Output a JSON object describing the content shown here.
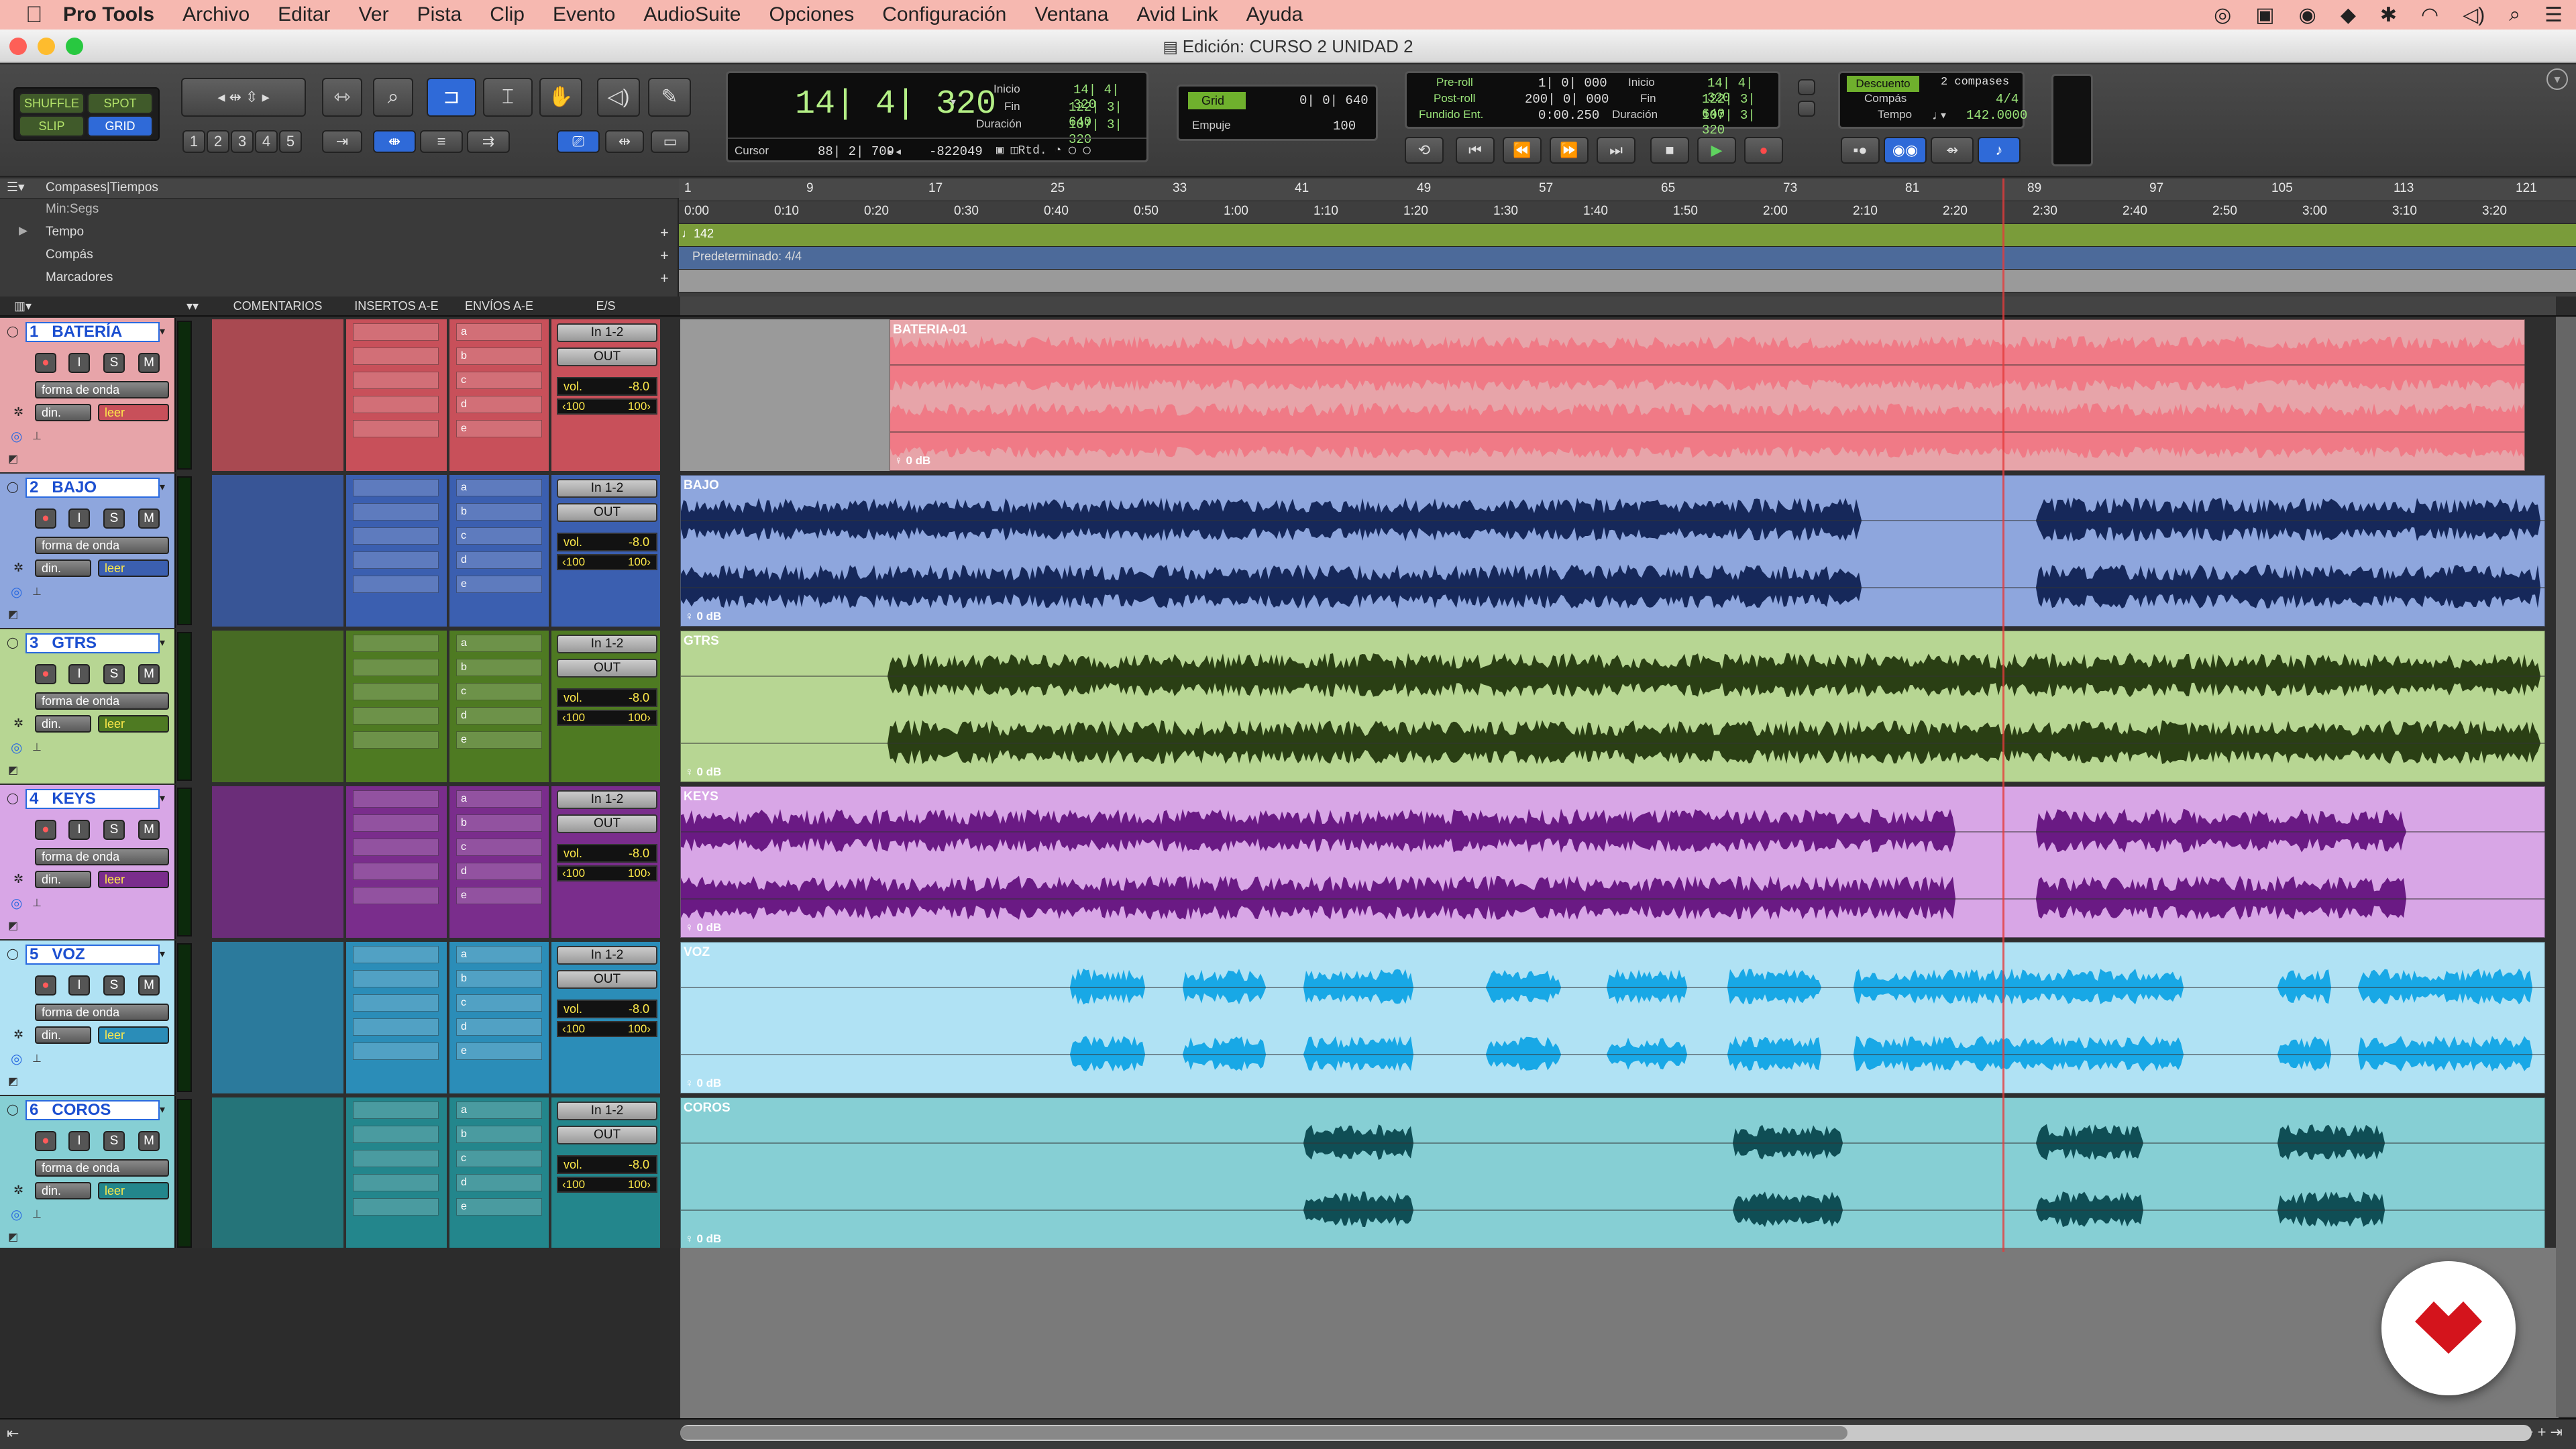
{
  "menubar": {
    "app": "Pro Tools",
    "items": [
      "Archivo",
      "Editar",
      "Ver",
      "Pista",
      "Clip",
      "Evento",
      "AudioSuite",
      "Opciones",
      "Configuración",
      "Ventana",
      "Avid Link",
      "Ayuda"
    ]
  },
  "window": {
    "title": "Edición: CURSO 2 UNIDAD 2"
  },
  "toolbar": {
    "modes": [
      "SHUFFLE",
      "SPOT",
      "SLIP",
      "GRID"
    ],
    "zoom_presets": [
      "1",
      "2",
      "3",
      "4",
      "5"
    ],
    "main_counter": "14| 4| 320",
    "sel_start_label": "Inicio",
    "sel_start": "14| 4| 320",
    "sel_end_label": "Fin",
    "sel_end": "122| 3| 640",
    "sel_len_label": "Duración",
    "sel_len": "107| 3| 320",
    "cursor_label": "Cursor",
    "cursor_value": "88| 2| 709",
    "cursor_sample": "-822049",
    "grid_label": "Grid",
    "grid_value": "0| 0| 640",
    "nudge_label": "Empuje",
    "nudge_value": "100",
    "preroll_label": "Pre-roll",
    "preroll_value": "1| 0| 000",
    "postroll_label": "Post-roll",
    "postroll_value": "200| 0| 000",
    "fadein_label": "Fundido Ent.",
    "fadein_value": "0:00.250",
    "t_start_label": "Inicio",
    "t_start": "14| 4| 320",
    "t_end_label": "Fin",
    "t_end": "122| 3| 640",
    "t_len_label": "Duración",
    "t_len": "107| 3| 320",
    "countoff_label": "Descuento",
    "countoff_value": "2 compases",
    "meter_label": "Compás",
    "meter_value": "4/4",
    "tempo_label": "Tempo",
    "tempo_value": "142.0000"
  },
  "rulers": {
    "header": "Compases|Tiempos",
    "rows": [
      "Min:Segs",
      "Tempo",
      "Compás",
      "Marcadores"
    ],
    "bars": [
      "1",
      "9",
      "17",
      "25",
      "33",
      "41",
      "49",
      "57",
      "65",
      "73",
      "81",
      "89",
      "97",
      "105",
      "113",
      "121"
    ],
    "times": [
      "0:00",
      "0:10",
      "0:20",
      "0:30",
      "0:40",
      "0:50",
      "1:00",
      "1:10",
      "1:20",
      "1:30",
      "1:40",
      "1:50",
      "2:00",
      "2:10",
      "2:20",
      "2:30",
      "2:40",
      "2:50",
      "3:00",
      "3:10",
      "3:20"
    ],
    "tempo_marker": "142",
    "meter_marker": "Predeterminado: 4/4"
  },
  "columns": {
    "comments": "COMENTARIOS",
    "inserts": "INSERTOS A-E",
    "sends": "ENVÍOS A-E",
    "io": "E/S"
  },
  "tracks": [
    {
      "num": "1",
      "name": "BATERÍA",
      "clip": "BATERIA-01",
      "color": "#c8505a",
      "light": "#e7a4a9",
      "wave": "#f07a86",
      "view": "forma de onda",
      "mode": "din.",
      "auto": "leer",
      "input": "In 1-2",
      "output": "OUT",
      "vol": "vol.",
      "volval": "-8.0",
      "pan_l": "‹100",
      "pan_r": "100›",
      "db": "0 dB"
    },
    {
      "num": "2",
      "name": "BAJO",
      "clip": "BAJO",
      "color": "#3b5fb0",
      "light": "#8ea6dd",
      "wave": "#16285a",
      "view": "forma de onda",
      "mode": "din.",
      "auto": "leer",
      "input": "In 1-2",
      "output": "OUT",
      "vol": "vol.",
      "volval": "-8.0",
      "pan_l": "‹100",
      "pan_r": "100›",
      "db": "0 dB"
    },
    {
      "num": "3",
      "name": "GTRS",
      "clip": "GTRS",
      "color": "#4e7a22",
      "light": "#b7d693",
      "wave": "#2a3f14",
      "view": "forma de onda",
      "mode": "din.",
      "auto": "leer",
      "input": "In 1-2",
      "output": "OUT",
      "vol": "vol.",
      "volval": "-8.0",
      "pan_l": "‹100",
      "pan_r": "100›",
      "db": "0 dB"
    },
    {
      "num": "4",
      "name": "KEYS",
      "clip": "KEYS",
      "color": "#7a2d8c",
      "light": "#d8a6e6",
      "wave": "#6a1a84",
      "view": "forma de onda",
      "mode": "din.",
      "auto": "leer",
      "input": "In 1-2",
      "output": "OUT",
      "vol": "vol.",
      "volval": "-8.0",
      "pan_l": "‹100",
      "pan_r": "100›",
      "db": "0 dB"
    },
    {
      "num": "5",
      "name": "VOZ",
      "clip": "VOZ",
      "color": "#2b8db8",
      "light": "#b0e2f4",
      "wave": "#18a8e6",
      "view": "forma de onda",
      "mode": "din.",
      "auto": "leer",
      "input": "In 1-2",
      "output": "OUT",
      "vol": "vol.",
      "volval": "-8.0",
      "pan_l": "‹100",
      "pan_r": "100›",
      "db": "0 dB"
    },
    {
      "num": "6",
      "name": "COROS",
      "clip": "COROS",
      "color": "#23868c",
      "light": "#86cfd4",
      "wave": "#0f4e55",
      "view": "forma de onda",
      "mode": "din.",
      "auto": "leer",
      "input": "In 1-2",
      "output": "OUT",
      "vol": "vol.",
      "volval": "-8.0",
      "pan_l": "‹100",
      "pan_r": "100›",
      "db": "0 dB"
    }
  ],
  "slots": {
    "inserts": [
      "",
      "",
      "",
      "",
      ""
    ],
    "sends": [
      "a",
      "b",
      "c",
      "d",
      "e"
    ]
  }
}
